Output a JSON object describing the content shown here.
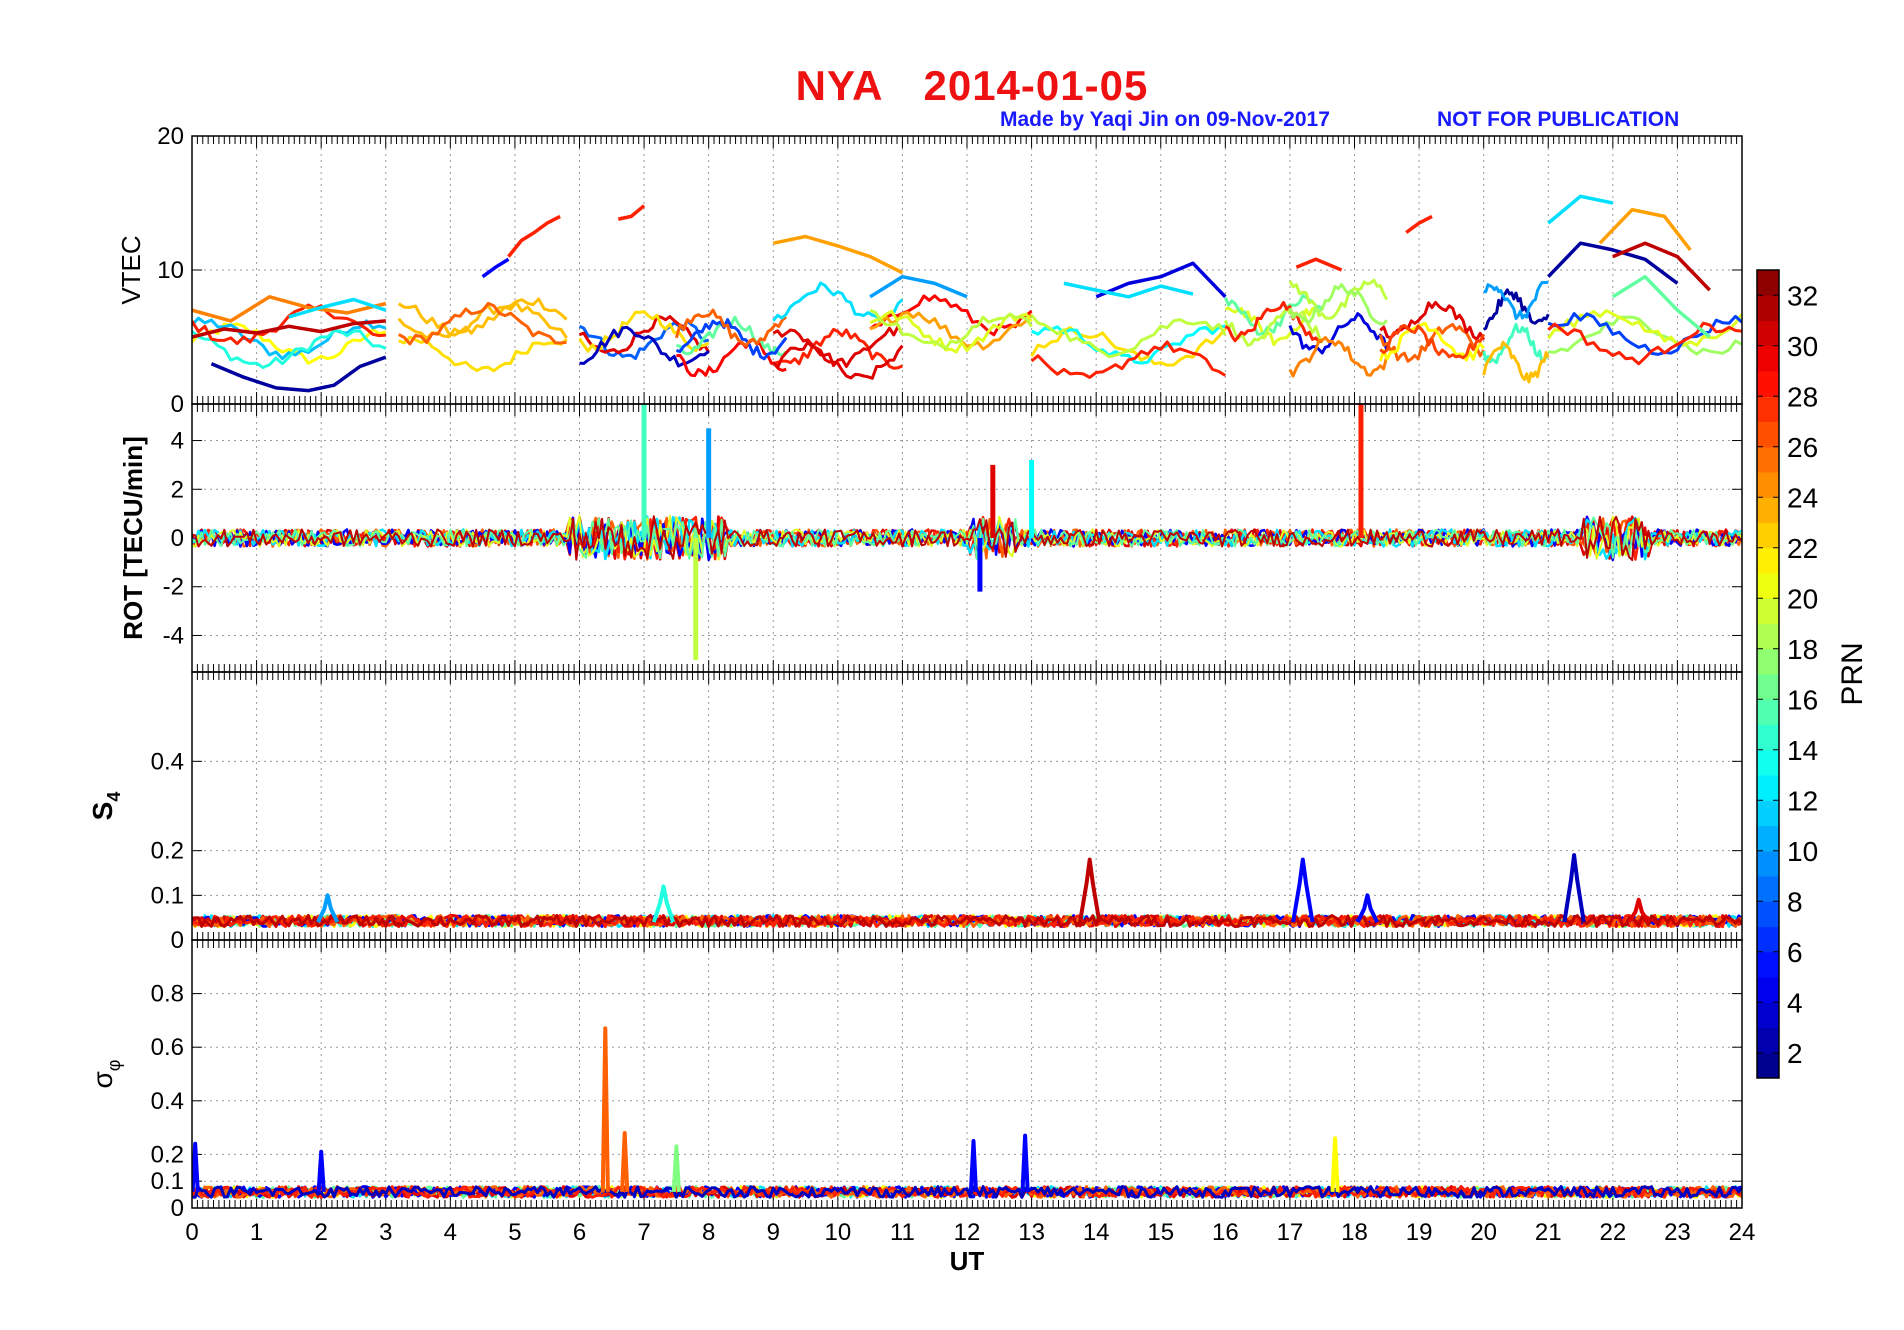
{
  "header": {
    "station": "NYA",
    "date": "2014-01-05",
    "credit": "Made by Yaqi Jin on 09-Nov-2017",
    "notice": "NOT FOR PUBLICATION"
  },
  "colors": {
    "title": "#ee1111",
    "credit": "#1a1aff",
    "axes": "#000000",
    "grid": "#888888"
  },
  "chart_data": [
    {
      "type": "line",
      "panel": "vtec",
      "ylabel": "VTEC",
      "xlim": [
        0,
        24
      ],
      "ylim": [
        0,
        20
      ],
      "yticks": [
        0,
        10,
        20
      ],
      "grid": true,
      "series_note": "one trace per GPS satellite PRN 1-32, colored by PRN",
      "traces": [
        {
          "prn": 2,
          "x": [
            0.3,
            0.8,
            1.3,
            1.8,
            2.2,
            2.6,
            3.0
          ],
          "y": [
            3.0,
            2.0,
            1.2,
            1.0,
            1.4,
            2.8,
            3.5
          ]
        },
        {
          "prn": 31,
          "x": [
            0.0,
            0.5,
            1.0,
            1.5,
            2.0,
            2.5,
            3.0
          ],
          "y": [
            5.0,
            5.6,
            5.3,
            5.8,
            5.4,
            6.0,
            6.2
          ]
        },
        {
          "prn": 25,
          "x": [
            0.0,
            0.6,
            1.2,
            1.8,
            2.4,
            3.0
          ],
          "y": [
            7.0,
            6.2,
            8.0,
            7.2,
            6.8,
            7.5
          ]
        },
        {
          "prn": 12,
          "x": [
            1.5,
            2.0,
            2.5,
            3.0
          ],
          "y": [
            6.5,
            7.2,
            7.8,
            7.0
          ]
        },
        {
          "prn": 28,
          "x": [
            4.9,
            5.1,
            5.3,
            5.5,
            5.7
          ],
          "y": [
            11.0,
            12.2,
            12.8,
            13.5,
            14.0
          ]
        },
        {
          "prn": 5,
          "x": [
            4.5,
            4.7,
            4.9
          ],
          "y": [
            9.5,
            10.2,
            10.8
          ]
        },
        {
          "prn": 28,
          "x": [
            6.6,
            6.8,
            7.0
          ],
          "y": [
            13.8,
            14.0,
            14.8
          ]
        },
        {
          "prn": 24,
          "x": [
            9.0,
            9.5,
            10.0,
            10.5,
            11.0
          ],
          "y": [
            12.0,
            12.5,
            11.8,
            11.0,
            9.8
          ]
        },
        {
          "prn": 10,
          "x": [
            10.5,
            11.0,
            11.5,
            12.0
          ],
          "y": [
            8.0,
            9.5,
            9.0,
            8.0
          ]
        },
        {
          "prn": 4,
          "x": [
            14.0,
            14.5,
            15.0,
            15.5,
            16.0
          ],
          "y": [
            8.0,
            9.0,
            9.5,
            10.5,
            8.0
          ]
        },
        {
          "prn": 12,
          "x": [
            13.5,
            14.0,
            14.5,
            15.0,
            15.5
          ],
          "y": [
            9.0,
            8.5,
            8.0,
            8.8,
            8.2
          ]
        },
        {
          "prn": 28,
          "x": [
            17.1,
            17.4,
            17.8
          ],
          "y": [
            10.2,
            10.8,
            10.0
          ]
        },
        {
          "prn": 28,
          "x": [
            18.8,
            19.0,
            19.2
          ],
          "y": [
            12.8,
            13.5,
            14.0
          ]
        },
        {
          "prn": 12,
          "x": [
            21.0,
            21.5,
            22.0
          ],
          "y": [
            13.5,
            15.5,
            15.0
          ]
        },
        {
          "prn": 24,
          "x": [
            21.8,
            22.3,
            22.8,
            23.2
          ],
          "y": [
            12.0,
            14.5,
            14.0,
            11.5
          ]
        },
        {
          "prn": 2,
          "x": [
            21.0,
            21.5,
            22.0,
            22.5,
            23.0
          ],
          "y": [
            9.5,
            12.0,
            11.5,
            10.8,
            9.0
          ]
        },
        {
          "prn": 31,
          "x": [
            22.0,
            22.5,
            23.0,
            23.5
          ],
          "y": [
            11.0,
            12.0,
            11.0,
            8.5
          ]
        },
        {
          "prn": 16,
          "x": [
            22.0,
            22.5,
            23.0,
            23.5
          ],
          "y": [
            8.0,
            9.5,
            7.0,
            5.0
          ]
        }
      ]
    },
    {
      "type": "line",
      "panel": "rot",
      "ylabel": "ROT [TECU/min]",
      "xlim": [
        0,
        24
      ],
      "ylim": [
        -5.5,
        5.5
      ],
      "yticks": [
        -4,
        -2,
        0,
        2,
        4
      ],
      "grid": true,
      "spikes": [
        {
          "prn": 15,
          "x": 7.0,
          "y": 5.5
        },
        {
          "prn": 19,
          "x": 7.8,
          "y": -5.0
        },
        {
          "prn": 10,
          "x": 8.0,
          "y": 4.5
        },
        {
          "prn": 28,
          "x": 18.1,
          "y": 5.5
        },
        {
          "prn": 30,
          "x": 12.4,
          "y": 3.0
        },
        {
          "prn": 5,
          "x": 12.2,
          "y": -2.2
        },
        {
          "prn": 13,
          "x": 13.0,
          "y": 3.2
        }
      ]
    },
    {
      "type": "line",
      "panel": "s4",
      "ylabel": "S4",
      "xlim": [
        0,
        24
      ],
      "ylim": [
        0,
        0.6
      ],
      "yticks": [
        0,
        0.1,
        0.2,
        0.4
      ],
      "grid": true,
      "peaks": [
        {
          "prn": 31,
          "x": 13.9,
          "y": 0.18
        },
        {
          "prn": 5,
          "x": 17.2,
          "y": 0.18
        },
        {
          "prn": 3,
          "x": 21.4,
          "y": 0.19
        },
        {
          "prn": 10,
          "x": 2.1,
          "y": 0.1
        },
        {
          "prn": 14,
          "x": 7.3,
          "y": 0.12
        },
        {
          "prn": 5,
          "x": 18.2,
          "y": 0.1
        },
        {
          "prn": 30,
          "x": 22.4,
          "y": 0.09
        }
      ]
    },
    {
      "type": "line",
      "panel": "sigma_phi",
      "ylabel": "σφ",
      "xlim": [
        0,
        24
      ],
      "ylim": [
        0,
        1.0
      ],
      "yticks": [
        0,
        0.1,
        0.2,
        0.4,
        0.6,
        0.8
      ],
      "xticks": [
        0,
        1,
        2,
        3,
        4,
        5,
        6,
        7,
        8,
        9,
        10,
        11,
        12,
        13,
        14,
        15,
        16,
        17,
        18,
        19,
        20,
        21,
        22,
        23,
        24
      ],
      "xlabel": "UT",
      "grid": true,
      "peaks": [
        {
          "prn": 26,
          "x": 6.4,
          "y": 0.67
        },
        {
          "prn": 5,
          "x": 0.05,
          "y": 0.24
        },
        {
          "prn": 5,
          "x": 2.0,
          "y": 0.21
        },
        {
          "prn": 5,
          "x": 12.1,
          "y": 0.25
        },
        {
          "prn": 5,
          "x": 12.9,
          "y": 0.27
        },
        {
          "prn": 21,
          "x": 17.7,
          "y": 0.26
        },
        {
          "prn": 26,
          "x": 6.7,
          "y": 0.28
        },
        {
          "prn": 17,
          "x": 7.5,
          "y": 0.23
        }
      ]
    },
    {
      "type": "heatmap",
      "panel": "colorbar",
      "label": "PRN",
      "range": [
        1,
        33
      ],
      "ticks": [
        2,
        4,
        6,
        8,
        10,
        12,
        14,
        16,
        18,
        20,
        22,
        24,
        26,
        28,
        30,
        32
      ],
      "colormap": "jet"
    }
  ]
}
